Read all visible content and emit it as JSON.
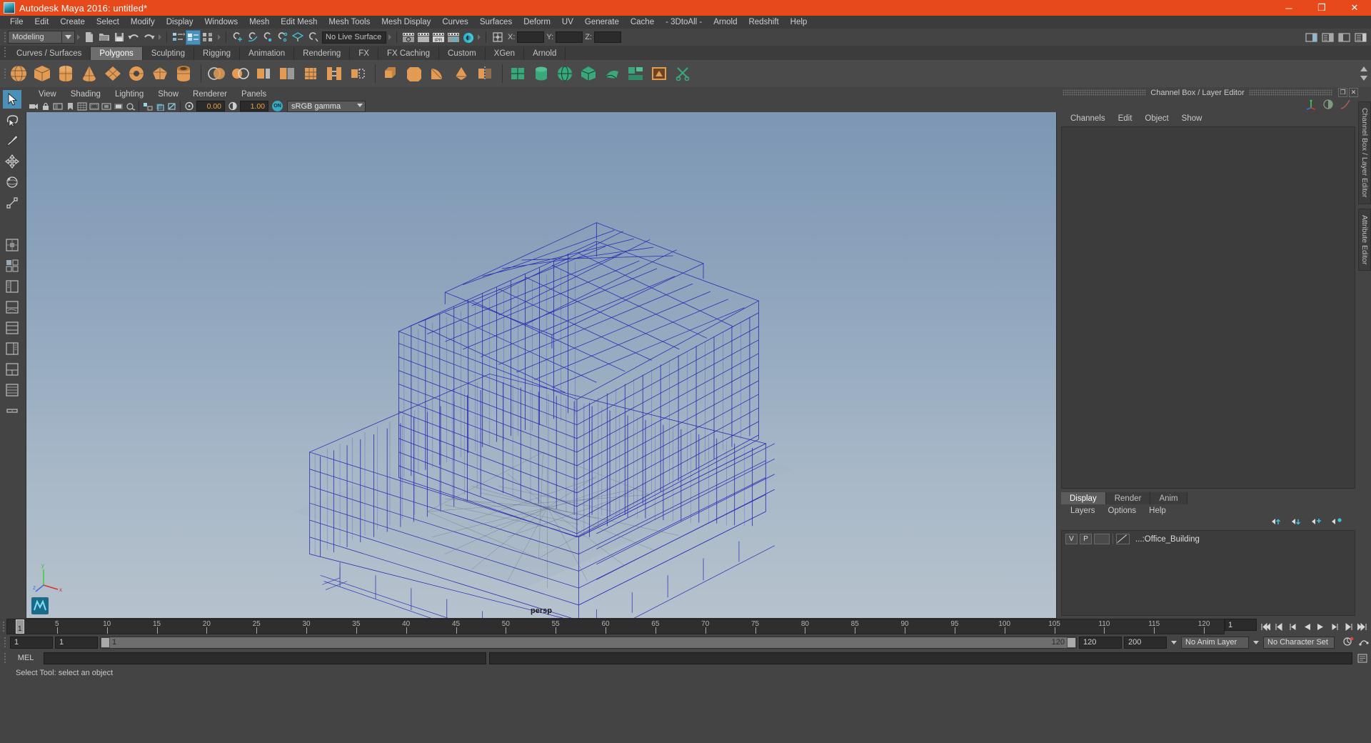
{
  "titlebar": {
    "title": "Autodesk Maya 2016: untitled*",
    "minimize": "─",
    "maximize": "❐",
    "close": "✕"
  },
  "menubar": {
    "items": [
      "File",
      "Edit",
      "Create",
      "Select",
      "Modify",
      "Display",
      "Windows",
      "Mesh",
      "Edit Mesh",
      "Mesh Tools",
      "Mesh Display",
      "Curves",
      "Surfaces",
      "Deform",
      "UV",
      "Generate",
      "Cache",
      "- 3DtoAll -",
      "Arnold",
      "Redshift",
      "Help"
    ]
  },
  "statusline": {
    "menuset": "Modeling",
    "live_surface": "No Live Surface",
    "coord_x_label": "X:",
    "coord_y_label": "Y:",
    "coord_z_label": "Z:",
    "coord_x_value": "",
    "coord_y_value": "",
    "coord_z_value": ""
  },
  "shelf": {
    "tabs": [
      "Curves / Surfaces",
      "Polygons",
      "Sculpting",
      "Rigging",
      "Animation",
      "Rendering",
      "FX",
      "FX Caching",
      "Custom",
      "XGen",
      "Arnold"
    ],
    "active_tab": "Polygons"
  },
  "viewport": {
    "menus": [
      "View",
      "Shading",
      "Lighting",
      "Show",
      "Renderer",
      "Panels"
    ],
    "exposure": "0.00",
    "gamma": "1.00",
    "on_badge": "ON",
    "color_management": "sRGB gamma",
    "camera_label": "persp",
    "axis_x": "x",
    "axis_y": "y",
    "axis_z": "z"
  },
  "channelbox": {
    "panel_title": "Channel Box / Layer Editor",
    "menus": [
      "Channels",
      "Edit",
      "Object",
      "Show"
    ],
    "restore_icon": "❐",
    "close_icon": "✕"
  },
  "layereditor": {
    "tabs": [
      "Display",
      "Render",
      "Anim"
    ],
    "active_tab": "Display",
    "menus": [
      "Layers",
      "Options",
      "Help"
    ],
    "rows": [
      {
        "visibility": "V",
        "playback": "P",
        "name": "...:Office_Building"
      }
    ]
  },
  "sidetabs": [
    "Channel Box / Layer Editor",
    "Attribute Editor"
  ],
  "timeline": {
    "current_frame": "1",
    "ticks": [
      5,
      10,
      15,
      20,
      25,
      30,
      35,
      40,
      45,
      50,
      55,
      60,
      65,
      70,
      75,
      80,
      85,
      90,
      95,
      100,
      105,
      110,
      115,
      120
    ],
    "range_start": "1",
    "range_end": "120",
    "playback_start": "1",
    "playback_end": "120",
    "anim_end": "200",
    "range_label_left": "1",
    "range_label_right": "120",
    "anim_layer": "No Anim Layer",
    "character_set": "No Character Set",
    "playback_frame_field": "1"
  },
  "command": {
    "mel_label": "MEL",
    "mel_value": "",
    "output_value": ""
  },
  "helpline": {
    "text": "Select Tool: select an object"
  },
  "colors": {
    "title_bar": "#e8491b",
    "chrome": "#444444",
    "panel": "#3c3c3c",
    "accent": "#4a90b8",
    "shelf_icon": "#e39b54",
    "wireframe": "#2323b4",
    "field_text": "#e8a33d"
  }
}
